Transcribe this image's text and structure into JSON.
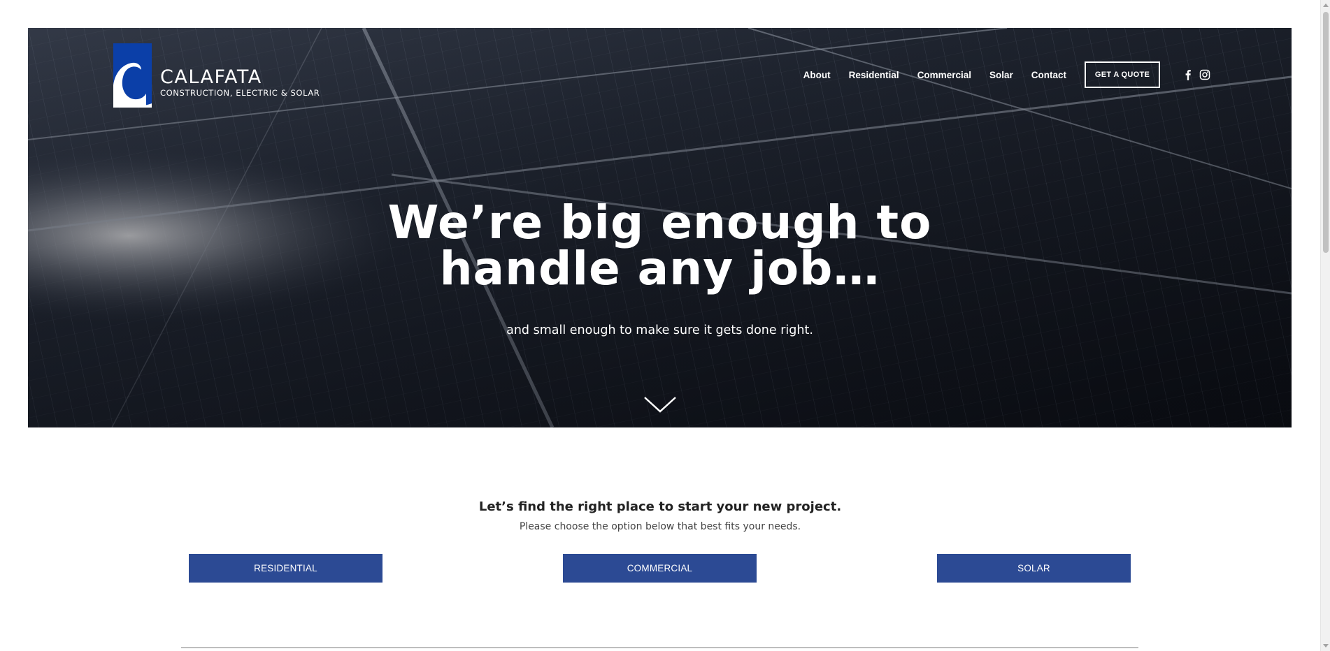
{
  "brand": {
    "name": "CALAFATA",
    "tagline": "CONSTRUCTION, ELECTRIC & SOLAR",
    "logo_icon": "calafata-c-logo-icon",
    "logo_color": "#0b3fa8"
  },
  "nav": {
    "items": [
      {
        "label": "About"
      },
      {
        "label": "Residential"
      },
      {
        "label": "Commercial"
      },
      {
        "label": "Solar"
      },
      {
        "label": "Contact"
      }
    ],
    "quote_button": "GET A QUOTE",
    "social": [
      "facebook-icon",
      "instagram-icon"
    ]
  },
  "hero": {
    "heading_line1": "We’re big enough to",
    "heading_line2": "handle any job…",
    "subheading": "and small enough to make sure it gets done right.",
    "scroll_icon": "chevron-down-icon"
  },
  "intro": {
    "title": "Let’s find the right place to start your new project.",
    "subtitle": "Please choose the option below that best fits your needs.",
    "options": [
      {
        "label": "RESIDENTIAL"
      },
      {
        "label": "COMMERCIAL"
      },
      {
        "label": "SOLAR"
      }
    ],
    "button_color": "#2c4a94"
  }
}
